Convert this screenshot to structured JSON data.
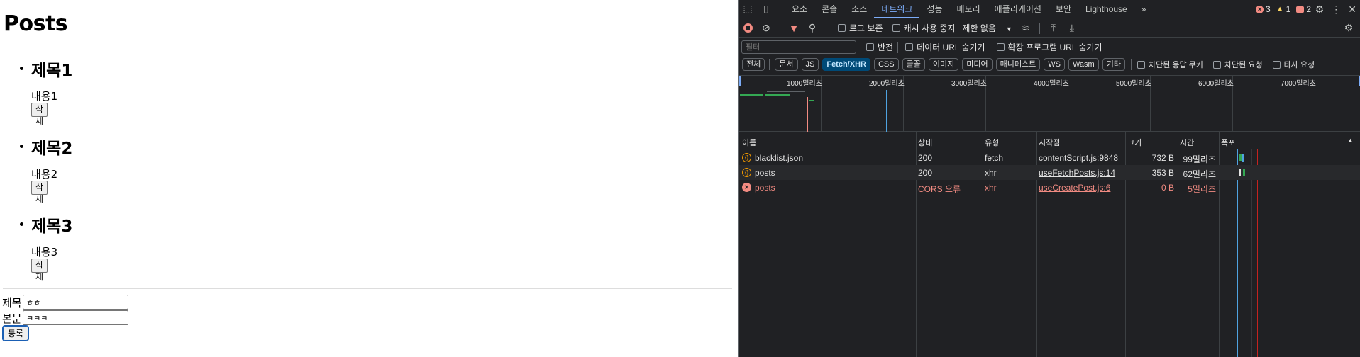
{
  "page": {
    "title": "Posts",
    "posts": [
      {
        "title": "제목1",
        "content": "내용1",
        "delete_label": "삭제"
      },
      {
        "title": "제목2",
        "content": "내용2",
        "delete_label": "삭제"
      },
      {
        "title": "제목3",
        "content": "내용3",
        "delete_label": "삭제"
      }
    ],
    "form": {
      "title_label": "제목",
      "title_value": "ㅎㅎ",
      "body_label": "본문",
      "body_value": "ㅋㅋㅋ",
      "submit_label": "등록"
    }
  },
  "devtools": {
    "tabs": [
      "요소",
      "콘솔",
      "소스",
      "네트워크",
      "성능",
      "메모리",
      "애플리케이션",
      "보안",
      "Lighthouse"
    ],
    "active_tab": "네트워크",
    "more_tabs": "»",
    "counts": {
      "errors": "3",
      "warnings": "1",
      "issues": "2"
    },
    "toolbar": {
      "preserve_log": "로그 보존",
      "disable_cache": "캐시 사용 중지",
      "throttle": "제한 없음"
    },
    "filter": {
      "placeholder": "필터",
      "invert": "반전",
      "hide_data_urls": "데이터 URL 숨기기",
      "hide_extension_urls": "확장 프로그램 URL 숨기기"
    },
    "type_filters": [
      "전체",
      "문서",
      "JS",
      "Fetch/XHR",
      "CSS",
      "글꼴",
      "이미지",
      "미디어",
      "매니페스트",
      "WS",
      "Wasm",
      "기타"
    ],
    "active_type": "Fetch/XHR",
    "type_checks": [
      "차단된 응답 쿠키",
      "차단된 요청",
      "타사 요청"
    ],
    "timeline_ticks": [
      "1000밀리초",
      "2000밀리초",
      "3000밀리초",
      "4000밀리초",
      "5000밀리초",
      "6000밀리초",
      "7000밀리초"
    ],
    "columns": [
      "이름",
      "상태",
      "유형",
      "시작점",
      "크기",
      "시간",
      "폭포"
    ],
    "requests": [
      {
        "name": "blacklist.json",
        "status": "200",
        "type": "fetch",
        "initiator": "contentScript.js:9848",
        "size": "732 B",
        "time": "99밀리초",
        "error": false
      },
      {
        "name": "posts",
        "status": "200",
        "type": "xhr",
        "initiator": "useFetchPosts.js:14",
        "size": "353 B",
        "time": "62밀리초",
        "error": false
      },
      {
        "name": "posts",
        "status": "CORS 오류",
        "type": "xhr",
        "initiator": "useCreatePost.js:6",
        "size": "0 B",
        "time": "5밀리초",
        "error": true
      }
    ],
    "colors": {
      "accent": "#7cacf8",
      "error": "#f28b82",
      "background": "#202124"
    }
  }
}
